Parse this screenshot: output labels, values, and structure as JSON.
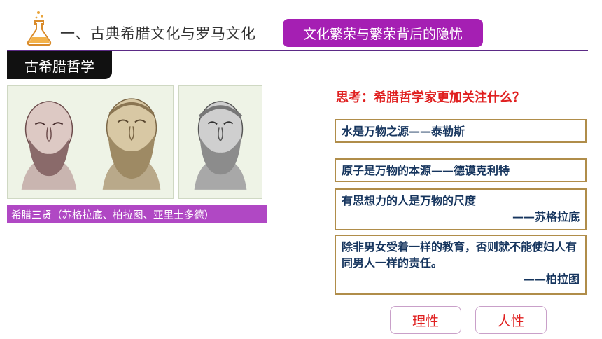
{
  "header": {
    "title": "一、古典希腊文化与罗马文化",
    "topic_button": "文化繁荣与繁荣背后的隐忧"
  },
  "section_tab": "古希腊哲学",
  "portraits": {
    "caption": "希腊三贤（苏格拉底、柏拉图、亚里士多德）"
  },
  "question": "思考：希腊哲学家更加关注什么？",
  "quotes": [
    {
      "line": "水是万物之源——泰勒斯"
    },
    {
      "line": "原子是万物的本源——德谟克利特"
    },
    {
      "line": "有思想力的人是万物的尺度",
      "author": "——苏格拉底"
    },
    {
      "line": "除非男女受着一样的教育，否则就不能使妇人有同男人一样的责任。",
      "author": "——柏拉图"
    }
  ],
  "answers": [
    "理性",
    "人性"
  ],
  "colors": {
    "accent_purple": "#a51fb3",
    "caption_purple": "#b048c4",
    "question_red": "#e02020",
    "quote_navy": "#16355e",
    "box_border": "#b08d4a"
  }
}
